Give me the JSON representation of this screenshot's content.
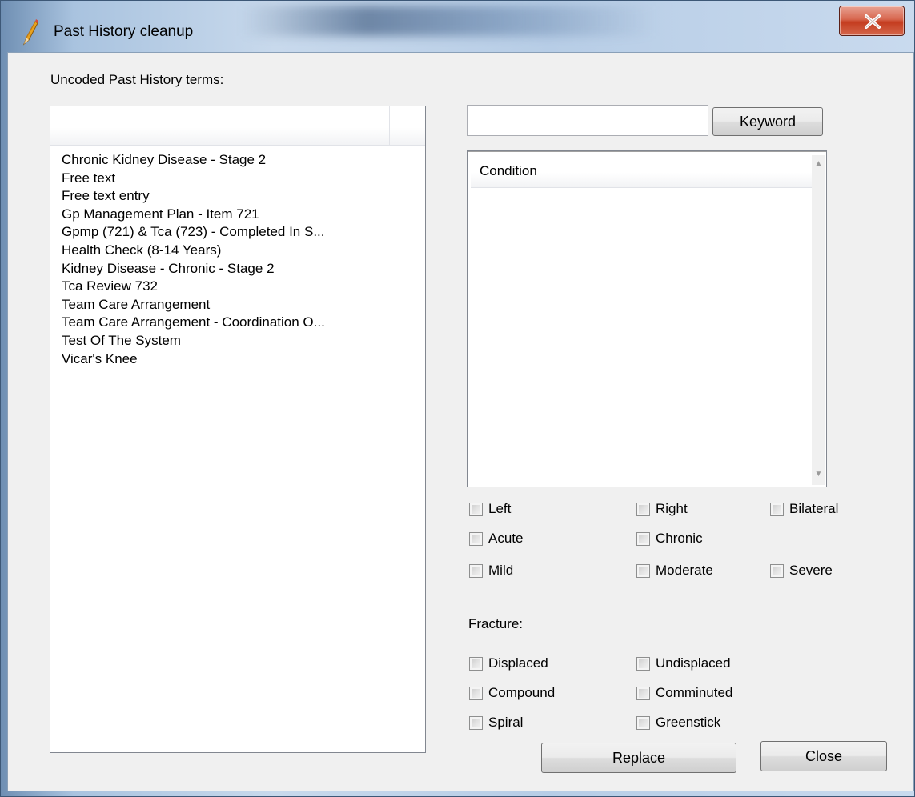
{
  "window": {
    "title": "Past History cleanup",
    "close_glyph": "X"
  },
  "left_panel": {
    "label": "Uncoded Past History terms:",
    "items": [
      "Chronic Kidney Disease - Stage 2",
      "Free text",
      "Free text entry",
      "Gp Management Plan - Item 721",
      "Gpmp (721) & Tca (723) - Completed In S...",
      "Health Check (8-14 Years)",
      "Kidney Disease - Chronic - Stage 2",
      "Tca Review 732",
      "Team Care Arrangement",
      "Team Care Arrangement - Coordination O...",
      "Test Of The System",
      "Vicar's Knee"
    ]
  },
  "search": {
    "value": "",
    "button_label": "Keyword"
  },
  "conditions": {
    "header": "Condition"
  },
  "modifiers": {
    "left": "Left",
    "right": "Right",
    "bilateral": "Bilateral",
    "acute": "Acute",
    "chronic": "Chronic",
    "mild": "Mild",
    "moderate": "Moderate",
    "severe": "Severe"
  },
  "fracture": {
    "label": "Fracture:",
    "displaced": "Displaced",
    "undisplaced": "Undisplaced",
    "compound": "Compound",
    "comminuted": "Comminuted",
    "spiral": "Spiral",
    "greenstick": "Greenstick"
  },
  "actions": {
    "replace_label": "Replace",
    "close_label": "Close"
  }
}
